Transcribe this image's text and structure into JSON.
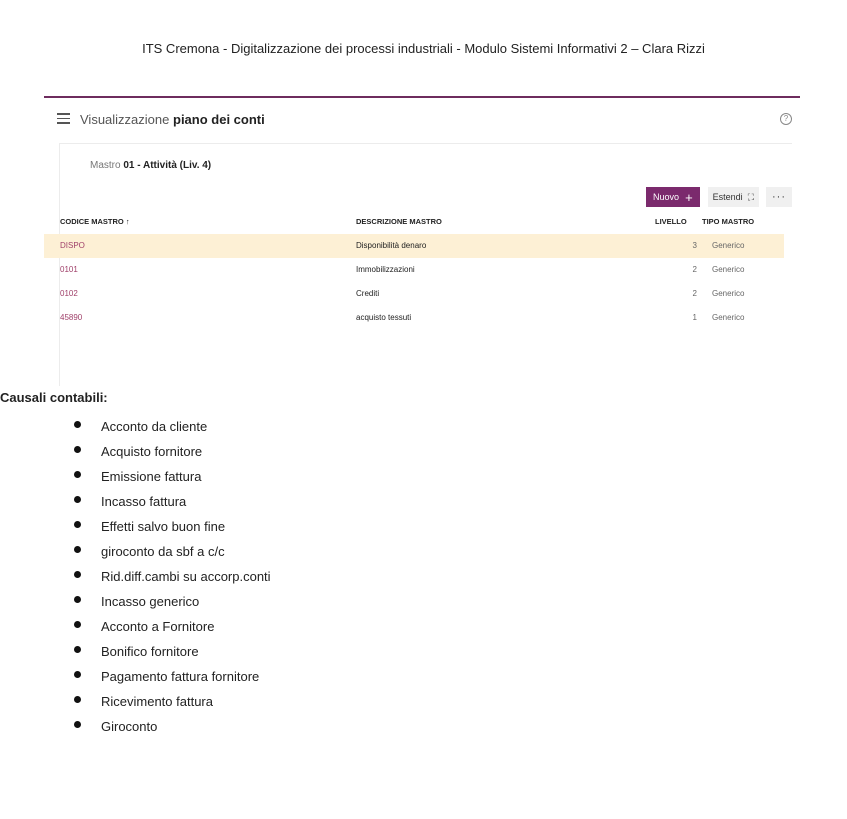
{
  "document": {
    "header": "ITS Cremona - Digitalizzazione dei processi industriali - Modulo Sistemi Informativi 2 – Clara Rizzi",
    "section_title": "Causali contabili:",
    "causali": [
      "Acconto da cliente",
      "Acquisto fornitore",
      "Emissione fattura",
      "Incasso fattura",
      "Effetti salvo buon fine",
      "giroconto da sbf a c/c",
      "Rid.diff.cambi su accorp.conti",
      "Incasso generico",
      "Acconto a Fornitore",
      "Bonifico fornitore",
      "Pagamento fattura fornitore",
      "Ricevimento fattura",
      "Giroconto"
    ]
  },
  "app": {
    "title_prefix": "Visualizzazione",
    "title_bold": "piano dei conti",
    "help_icon": "help-circle-icon",
    "mastro_label": "Mastro",
    "mastro_value": "01 - Attività (Liv. 4)",
    "toolbar": {
      "new_label": "Nuovo",
      "new_icon": "+",
      "extend_label": "Estendi",
      "extend_icon": "⛶",
      "more_icon": "···"
    },
    "accent_color": "#7b2a6d",
    "table": {
      "columns": {
        "code": "CODICE MASTRO",
        "code_sort": "↑",
        "desc": "DESCRIZIONE MASTRO",
        "level": "LIVELLO",
        "type": "TIPO MASTRO"
      },
      "rows": [
        {
          "code": "DISPO",
          "desc": "Disponibilità denaro",
          "level": "3",
          "type": "Generico"
        },
        {
          "code": "0101",
          "desc": "Immobilizzazioni",
          "level": "2",
          "type": "Generico"
        },
        {
          "code": "0102",
          "desc": "Crediti",
          "level": "2",
          "type": "Generico"
        },
        {
          "code": "45890",
          "desc": "acquisto tessuti",
          "level": "1",
          "type": "Generico"
        }
      ]
    }
  }
}
